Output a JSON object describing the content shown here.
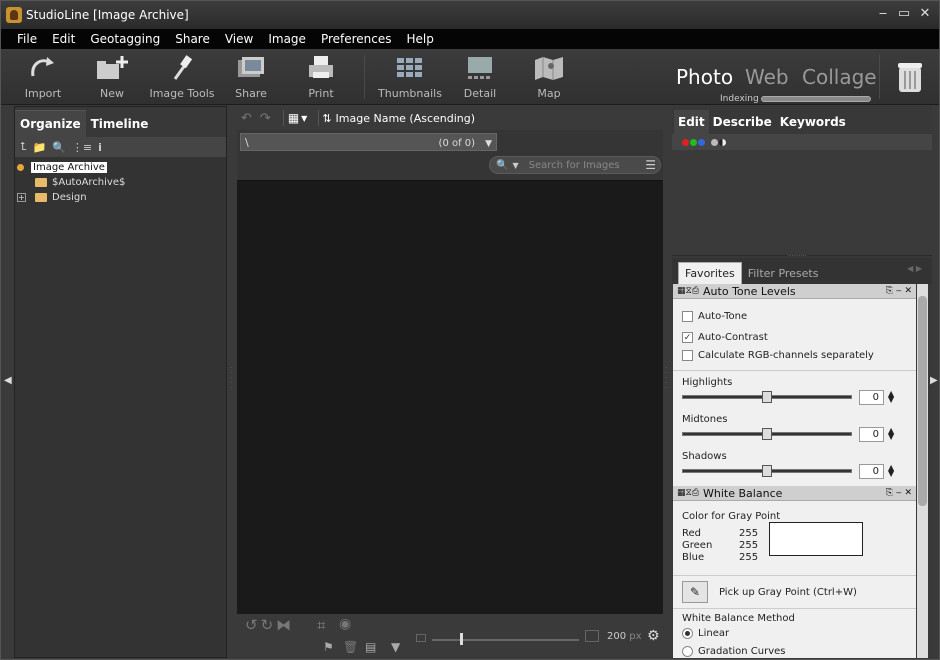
{
  "window": {
    "title": "StudioLine [Image Archive]"
  },
  "menu": [
    "File",
    "Edit",
    "Geotagging",
    "Share",
    "View",
    "Image",
    "Preferences",
    "Help"
  ],
  "toolbar": {
    "import": "Import",
    "new": "New",
    "image_tools": "Image Tools",
    "share": "Share",
    "print": "Print",
    "thumbnails": "Thumbnails",
    "detail": "Detail",
    "map": "Map",
    "mode_photo": "Photo",
    "mode_web": "Web",
    "mode_collage": "Collage",
    "indexing": "Indexing"
  },
  "left": {
    "tab_organize": "Organize",
    "tab_timeline": "Timeline",
    "tree": {
      "root": "Image Archive",
      "child1": "$AutoArchive$",
      "child2": "Design"
    }
  },
  "center": {
    "sort": "Image Name (Ascending)",
    "path": "\\",
    "count": "(0 of 0)",
    "search_placeholder": "Search for Images",
    "zoom_value": "200",
    "zoom_unit": "px"
  },
  "right": {
    "tab_edit": "Edit",
    "tab_describe": "Describe",
    "tab_keywords": "Keywords",
    "tab_favorites": "Favorites",
    "tab_filter_presets": "Filter Presets",
    "auto_tone": {
      "title": "Auto Tone Levels",
      "auto_tone": "Auto-Tone",
      "auto_contrast": "Auto-Contrast",
      "rgb_sep": "Calculate RGB-channels separately",
      "highlights": "Highlights",
      "highlights_val": "0",
      "highlights_level": 0.5,
      "midtones": "Midtones",
      "midtones_val": "0",
      "midtones_level": 0.5,
      "shadows": "Shadows",
      "shadows_val": "0",
      "shadows_level": 0.5
    },
    "white_balance": {
      "title": "White Balance",
      "gray_point": "Color for Gray Point",
      "red": "Red",
      "red_val": "255",
      "green": "Green",
      "green_val": "255",
      "blue": "Blue",
      "blue_val": "255",
      "pick": "Pick up Gray Point (Ctrl+W)",
      "method": "White Balance Method",
      "linear": "Linear",
      "gradation": "Gradation Curves"
    }
  },
  "colors": {
    "accent_red": "#d22",
    "accent_green": "#2b2",
    "accent_blue": "#36d"
  }
}
